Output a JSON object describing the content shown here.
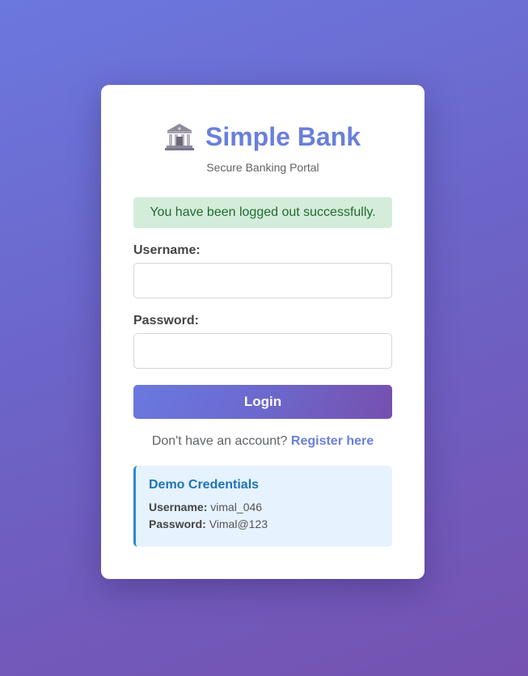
{
  "header": {
    "icon": "bank-icon",
    "title": "Simple Bank",
    "subtitle": "Secure Banking Portal"
  },
  "alert": {
    "message": "You have been logged out successfully."
  },
  "form": {
    "username_label": "Username:",
    "username_value": "",
    "password_label": "Password:",
    "password_value": "",
    "login_label": "Login"
  },
  "register": {
    "prompt": "Don't have an account?",
    "link_label": "Register here"
  },
  "demo": {
    "title": "Demo Credentials",
    "username_label": "Username:",
    "username_value": "vimal_046",
    "password_label": "Password:",
    "password_value": "Vimal@123"
  },
  "colors": {
    "accent": "#6a7fdb",
    "success_bg": "#d4edda",
    "success_text": "#216a32",
    "info_bg": "#e6f2fd",
    "info_border": "#2a8bd1",
    "info_title": "#1e74b8"
  }
}
